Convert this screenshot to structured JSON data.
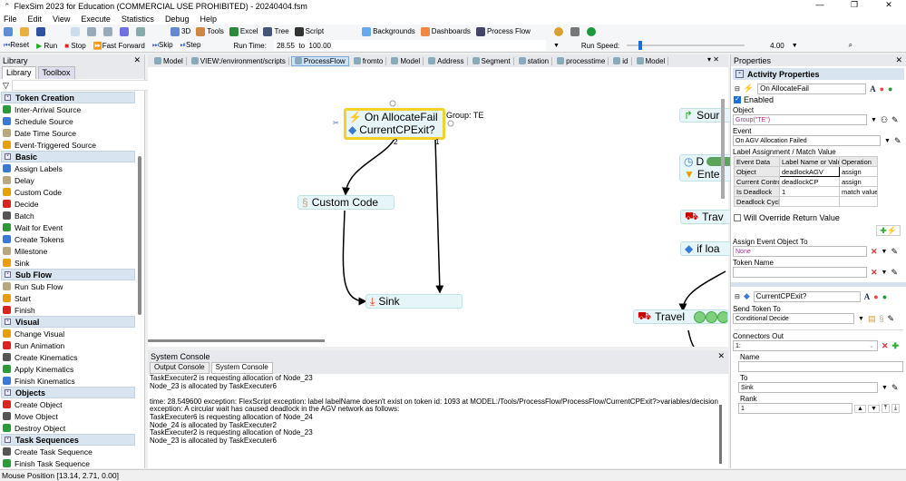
{
  "window": {
    "title": "FlexSim 2023 for Education (COMMERCIAL USE PROHIBITED) - 20240404.fsm",
    "minimize": "—",
    "maximize": "❐",
    "close": "✕"
  },
  "menu": [
    "File",
    "Edit",
    "View",
    "Execute",
    "Statistics",
    "Debug",
    "Help"
  ],
  "toolbar": {
    "view3d": "3D",
    "tools": "Tools",
    "excel": "Excel",
    "tree": "Tree",
    "script": "Script",
    "backgrounds": "Backgrounds",
    "dashboards": "Dashboards",
    "process_flow": "Process Flow"
  },
  "runbar": {
    "reset": "Reset",
    "run": "Run",
    "stop": "Stop",
    "fast_forward": "Fast Forward",
    "skip": "Skip",
    "step": "Step",
    "run_time_label": "Run Time:",
    "run_time_value": "28.55  to  100.00",
    "run_speed_label": "Run Speed:",
    "run_speed_value": "4.00",
    "run_speed_fraction": 0.1
  },
  "library": {
    "title": "Library",
    "tabs": [
      "Library",
      "Toolbox"
    ],
    "categories": [
      {
        "name": "Token Creation",
        "items": [
          "Inter-Arrival Source",
          "Schedule Source",
          "Date Time Source",
          "Event-Triggered Source"
        ]
      },
      {
        "name": "Basic",
        "items": [
          "Assign Labels",
          "Delay",
          "Custom Code",
          "Decide",
          "Batch",
          "Wait for Event",
          "Create Tokens",
          "Milestone",
          "Sink"
        ]
      },
      {
        "name": "Sub Flow",
        "items": [
          "Run Sub Flow",
          "Start",
          "Finish"
        ]
      },
      {
        "name": "Visual",
        "items": [
          "Change Visual",
          "Run Animation",
          "Create Kinematics",
          "Apply Kinematics",
          "Finish Kinematics"
        ]
      },
      {
        "name": "Objects",
        "items": [
          "Create Object",
          "Move Object",
          "Destroy Object"
        ]
      },
      {
        "name": "Task Sequences",
        "items": [
          "Create Task Sequence",
          "Finish Task Sequence"
        ]
      }
    ]
  },
  "doc_tabs": [
    "Model",
    "VIEW:/environment/scripts",
    "ProcessFlow",
    "fromto",
    "Model",
    "Address",
    "Segment",
    "station",
    "processtime",
    "id",
    "Model"
  ],
  "canvas": {
    "block_top": "On AllocateFail",
    "block_bottom": "CurrentCPExit?",
    "group_label": "Group: TE",
    "port2": "2",
    "port1": "1",
    "custom_code": "Custom Code",
    "sink": "Sink",
    "source": "Sour",
    "delay": "D",
    "enter": "Ente",
    "travel1": "Trav",
    "if_load": "if loa",
    "travel2": "Travel"
  },
  "console": {
    "title": "System Console",
    "tabs": [
      "Output Console",
      "System Console"
    ],
    "lines": [
      "TaskExecuter2 is requesting allocation of Node_23",
      "Node_23 is allocated by TaskExecuter6",
      "",
      "time: 28.549600 exception: FlexScript exception: label labelName doesn't exist on token id: 1093 at MODEL:/Tools/ProcessFlow/ProcessFlow/CurrentCPExit?>variables/decision",
      "exception: A circular wait has caused deadlock in the AGV network as follows:",
      "TaskExecuter6 is requesting allocation of Node_24",
      "Node_24 is allocated by TaskExecuter2",
      "TaskExecuter2 is requesting allocation of Node_23",
      "Node_23 is allocated by TaskExecuter6"
    ]
  },
  "properties": {
    "title": "Properties",
    "section": "Activity Properties",
    "activity_name": "On AllocateFail",
    "enabled": "Enabled",
    "object_label": "Object",
    "object_value": "Group(\"TE\")",
    "event_label": "Event",
    "event_value": "On AGV Allocation Failed",
    "label_assign_title": "Label Assignment / Match Value",
    "table_headers": [
      "Event Data",
      "Label Name or Value",
      "Operation"
    ],
    "table_rows": [
      [
        "Object",
        "deadlockAGV",
        "assign"
      ],
      [
        "Current Contro",
        "deadlockCP",
        "assign"
      ],
      [
        "Is Deadlock",
        "1",
        "match value"
      ],
      [
        "Deadlock Cycle",
        "",
        ""
      ]
    ],
    "override": "Will Override Return Value",
    "assign_event_label": "Assign Event Object To",
    "assign_event_value": "None",
    "token_name_label": "Token Name",
    "token_name_value": "",
    "decide_name": "CurrentCPExit?",
    "send_token_label": "Send Token To",
    "send_token_value": "Conditional Decide",
    "connectors_label": "Connectors Out",
    "connector_value": "1:",
    "name_label": "Name",
    "name_value": "",
    "to_label": "To",
    "to_value": "Sink",
    "rank_label": "Rank",
    "rank_value": "1"
  },
  "status": {
    "mouse_position": "Mouse Position [13.14, 2.71, 0.00]"
  }
}
